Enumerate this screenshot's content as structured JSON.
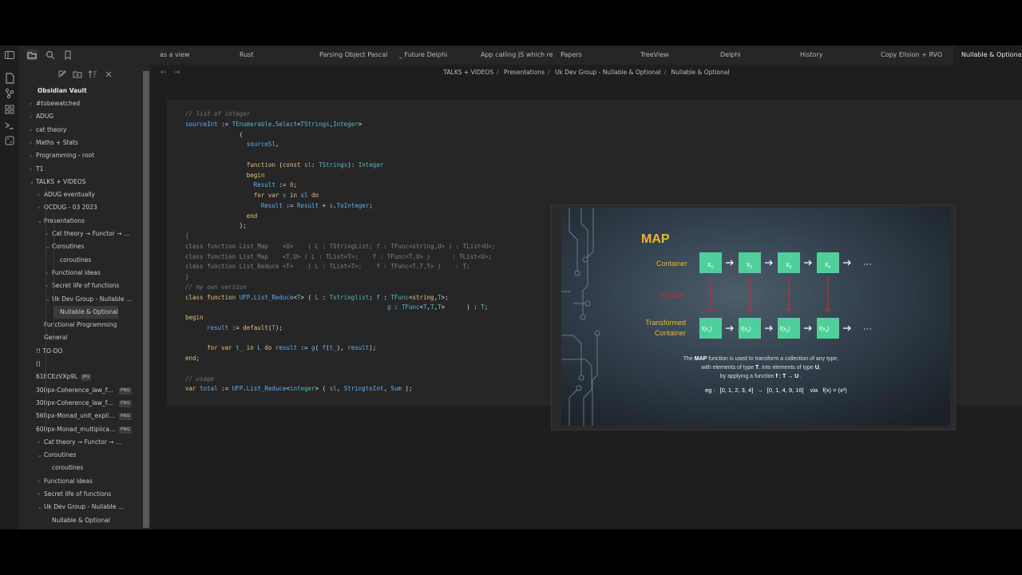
{
  "topbar": {
    "tabs": [
      {
        "label": "as a view"
      },
      {
        "label": "Rust"
      },
      {
        "label": "Parsing Object Pascal"
      },
      {
        "label": "_ Future Delphi"
      },
      {
        "label": "App calling JS which res..."
      },
      {
        "label": "Papers"
      },
      {
        "label": "TreeView"
      },
      {
        "label": "Delphi"
      },
      {
        "label": "History"
      },
      {
        "label": "Copy Elision + RVO"
      },
      {
        "label": "Nullable & Optional"
      }
    ],
    "icons": [
      "sidebar-toggle-icon",
      "folder-icon",
      "search-icon",
      "bookmark-icon"
    ]
  },
  "ribbon": {
    "icons": [
      "files-icon",
      "graph-icon",
      "canvas-icon",
      "terminal-icon",
      "dice-icon"
    ]
  },
  "sidebar": {
    "tools": [
      "new-note-icon",
      "new-folder-icon",
      "sort-icon",
      "collapse-icon"
    ],
    "vault_title": "Obsidian Vault",
    "items": [
      {
        "label": "#tobewatched",
        "chev": "›"
      },
      {
        "label": "ADUG",
        "chev": "›"
      },
      {
        "label": "cat theory",
        "chev": "›"
      },
      {
        "label": "Maths + Stats",
        "chev": "›"
      },
      {
        "label": "Programming - root",
        "chev": "›"
      },
      {
        "label": "T1",
        "chev": "›"
      },
      {
        "label": "TALKS + VIDEOS",
        "chev": "⌄"
      },
      {
        "label": "ADUG eventually",
        "chev": "›"
      },
      {
        "label": "OCDUG - 03 2023",
        "chev": "›"
      },
      {
        "label": "Presentations",
        "chev": "⌄"
      },
      {
        "label": "Cat theory → Functor → M...",
        "chev": "›"
      },
      {
        "label": "Coroutines",
        "chev": "⌄"
      },
      {
        "label": "coroutines",
        "chev": ""
      },
      {
        "label": "Functional ideas",
        "chev": "›"
      },
      {
        "label": "Secret life of functions",
        "chev": "›"
      },
      {
        "label": "Uk Dev Group - Nullable ...",
        "chev": "⌄"
      },
      {
        "label": "Nullable & Optional",
        "chev": ""
      },
      {
        "label": "Functional Programming",
        "chev": ""
      },
      {
        "label": "General",
        "chev": ""
      },
      {
        "label": "!! TO-DO",
        "chev": ""
      },
      {
        "label": "()",
        "chev": ""
      },
      {
        "label": "61ECEzVXp9L",
        "chev": "",
        "badge": "JPG"
      },
      {
        "label": "300px-Coherence_law_for_...",
        "chev": "",
        "badge": "PNG"
      },
      {
        "label": "300px-Coherence_law_for_...",
        "chev": "",
        "badge": "PNG"
      },
      {
        "label": "568px-Monad_unit_explici...",
        "chev": "",
        "badge": "PNG"
      },
      {
        "label": "600px-Monad_multiplicati...",
        "chev": "",
        "badge": "PNG"
      },
      {
        "label": "Cat theory → Functor → M...",
        "chev": "›"
      },
      {
        "label": "Coroutines",
        "chev": "⌄"
      },
      {
        "label": "coroutines",
        "chev": ""
      },
      {
        "label": "Functional ideas",
        "chev": "›"
      },
      {
        "label": "Secret life of functions",
        "chev": "›"
      },
      {
        "label": "Uk Dev Group - Nullable ...",
        "chev": "⌄"
      },
      {
        "label": "Nullable & Optional",
        "chev": ""
      }
    ]
  },
  "main": {
    "breadcrumb": [
      "TALKS + VIDEOS",
      "Presentations",
      "Uk Dev Group - Nullable & Optional",
      "Nullable & Optional"
    ],
    "slide": {
      "title": "MAP",
      "container_label": "Container",
      "function_label": "Function",
      "transformed_label_1": "Transformed",
      "transformed_label_2": "Container",
      "xs": [
        "x",
        "x",
        "x",
        "x"
      ],
      "subs": [
        "1",
        "2",
        "3",
        "4"
      ],
      "fx_prefix": "f(x",
      "f_label": "f",
      "ellipsis": "···",
      "desc1_a": "The ",
      "desc1_b": "MAP",
      "desc1_c": " function is used to transform a collection of any type,",
      "desc2_a": "with elements of type ",
      "desc2_b": "T",
      "desc2_c": ",  into elements of type ",
      "desc2_d": "U",
      "desc2_e": ",",
      "desc3_a": "by applying a function ",
      "desc3_b": "f : T → U",
      "desc3_c": " .",
      "eg_label": "eg :",
      "eg_in": "[0, 1, 2, 3, 4]",
      "eg_arrow": "→",
      "eg_out": "[0, 1, 4, 9, 16]",
      "eg_via": "via",
      "eg_fn": "f(x) = (x²)"
    }
  }
}
